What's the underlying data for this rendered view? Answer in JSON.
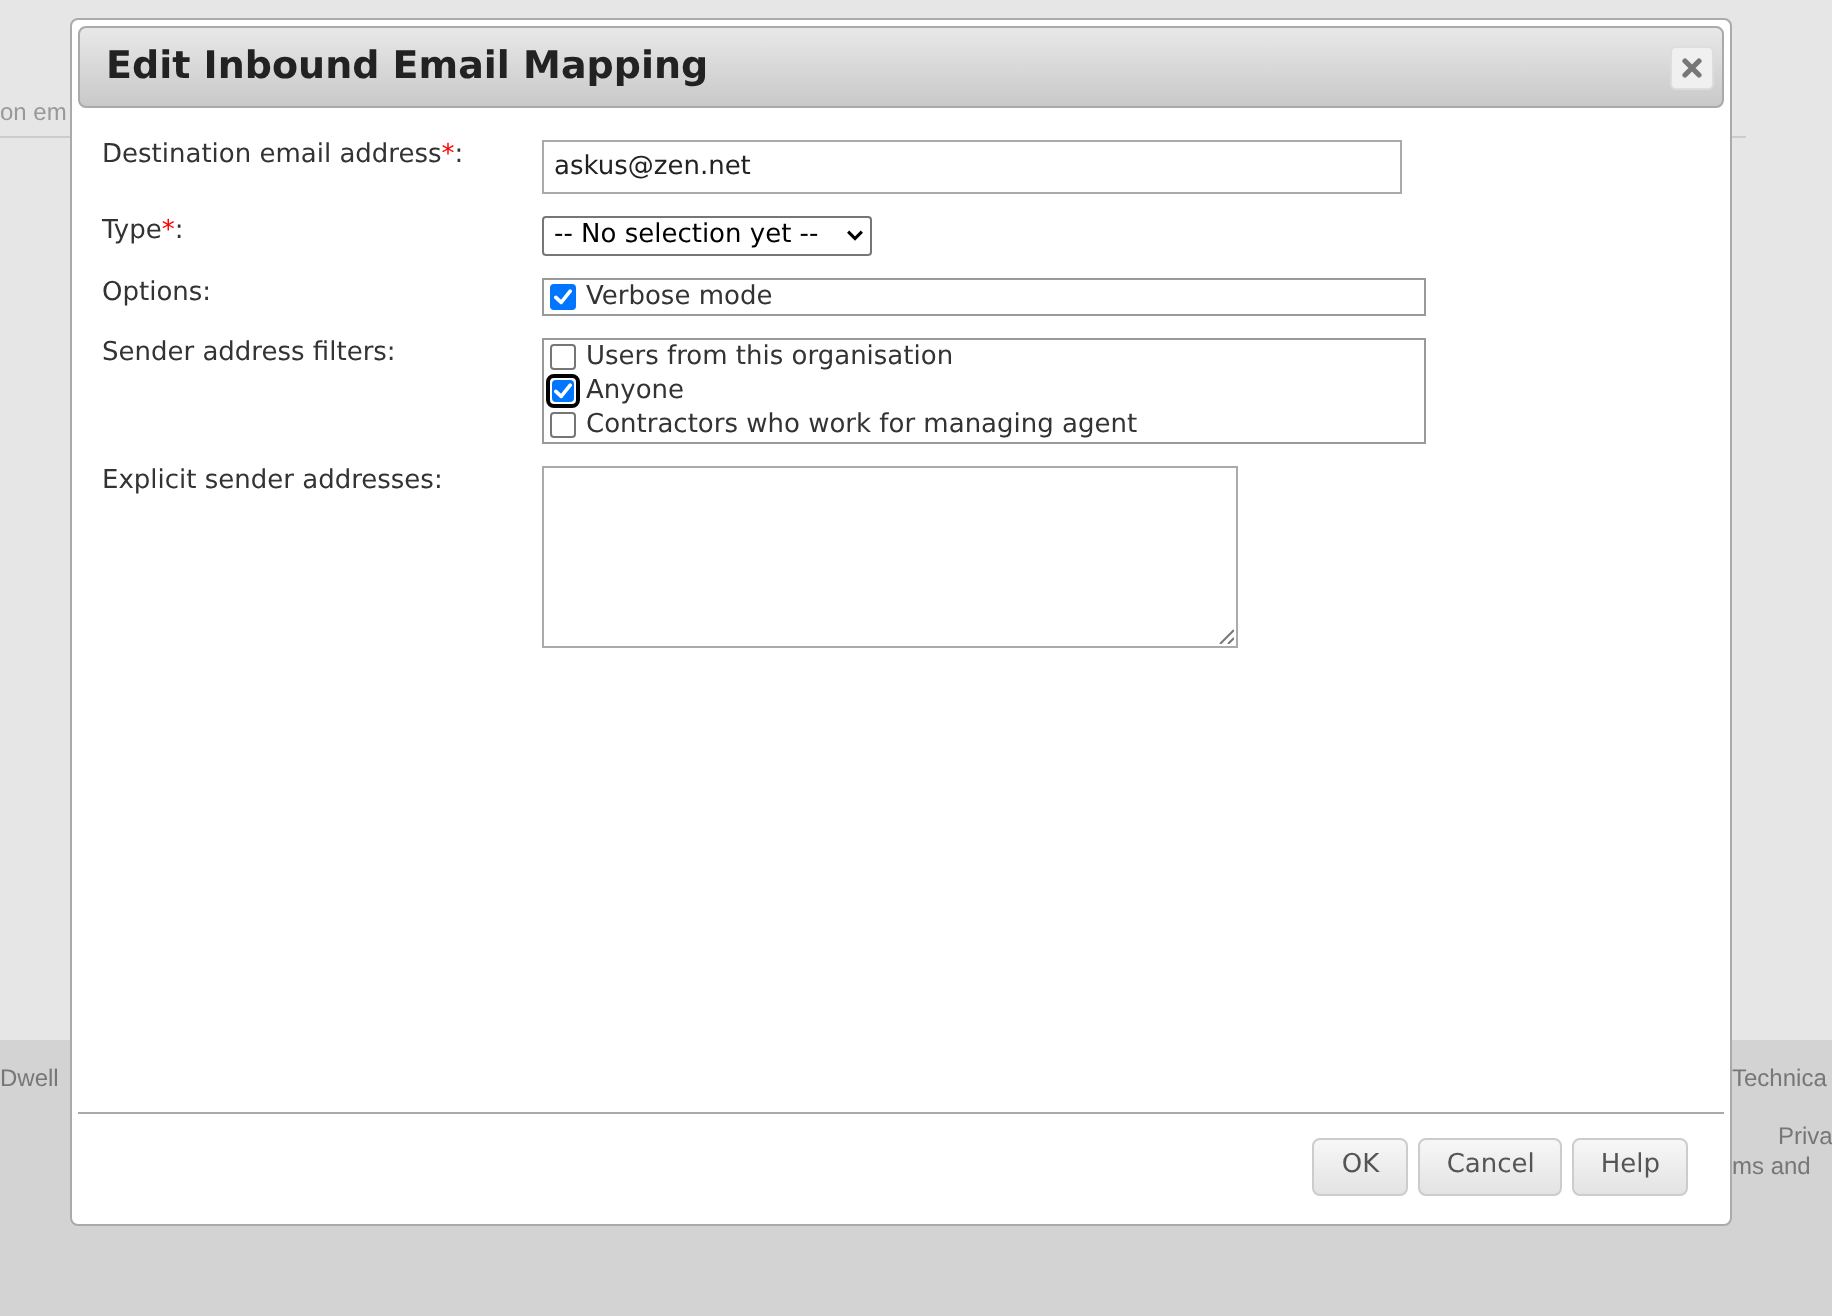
{
  "background": {
    "header_text": "on em",
    "footer_left": "Dwell",
    "footer_right": [
      "Technica",
      "Priva",
      "ms and"
    ]
  },
  "dialog": {
    "title": "Edit Inbound Email Mapping",
    "fields": [
      {
        "kind": "text",
        "label": "Destination email address",
        "required_mark": "*",
        "label_end": ":",
        "value": "askus@zen.net"
      },
      {
        "kind": "select",
        "label": "Type",
        "required_mark": "*",
        "label_end": ":",
        "value": "-- No selection yet --"
      },
      {
        "kind": "checklist",
        "label": "Options:",
        "options": [
          {
            "label": "Verbose mode",
            "checked": true,
            "focused": false
          }
        ]
      },
      {
        "kind": "checklist",
        "label": "Sender address filters:",
        "options": [
          {
            "label": "Users from this organisation",
            "checked": false,
            "focused": false
          },
          {
            "label": "Anyone",
            "checked": true,
            "focused": true
          },
          {
            "label": "Contractors who work for managing agent",
            "checked": false,
            "focused": false
          }
        ]
      },
      {
        "kind": "textarea",
        "label": "Explicit sender addresses:"
      }
    ],
    "buttons": [
      "OK",
      "Cancel",
      "Help"
    ]
  }
}
